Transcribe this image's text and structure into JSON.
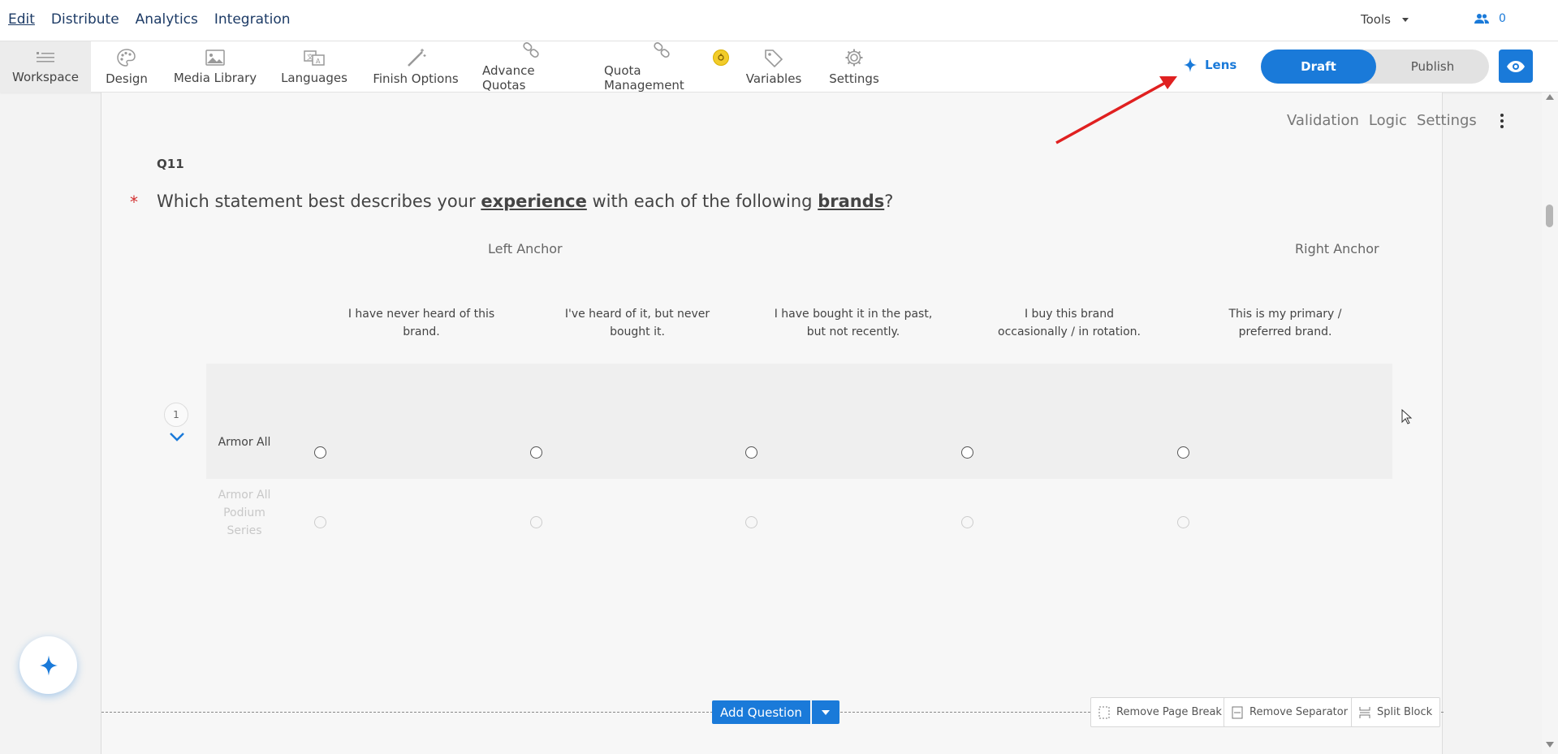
{
  "topnav": {
    "items": [
      "Edit",
      "Distribute",
      "Analytics",
      "Integration"
    ],
    "tools_label": "Tools",
    "user_count": "0"
  },
  "toolbar": {
    "items": [
      {
        "label": "Workspace",
        "icon": "workspace-icon"
      },
      {
        "label": "Design",
        "icon": "palette-icon"
      },
      {
        "label": "Media Library",
        "icon": "image-icon"
      },
      {
        "label": "Languages",
        "icon": "translate-icon"
      },
      {
        "label": "Finish Options",
        "icon": "magic-wand-icon"
      },
      {
        "label": "Advance Quotas",
        "icon": "link-icon"
      },
      {
        "label": "Quota Management",
        "icon": "link-icon"
      },
      {
        "label": "Variables",
        "icon": "tag-icon"
      },
      {
        "label": "Settings",
        "icon": "gear-icon"
      }
    ],
    "lens_label": "Lens",
    "draft_label": "Draft",
    "publish_label": "Publish"
  },
  "question": {
    "actions": [
      "Validation",
      "Logic",
      "Settings"
    ],
    "number": "Q11",
    "required_mark": "*",
    "text_parts": [
      "Which statement best describes your ",
      "experience",
      " with each of the following ",
      "brands",
      "?"
    ],
    "left_anchor": "Left Anchor",
    "right_anchor": "Right Anchor",
    "columns": [
      "I have never heard of this brand.",
      "I've heard of it, but never bought it.",
      "I have bought it in the past, but not recently.",
      "I buy this brand occasionally / in rotation.",
      "This is my primary / preferred brand."
    ],
    "rows": [
      "Armor All",
      "Armor All Podium Series"
    ],
    "row_number": "1"
  },
  "bottom": {
    "add_question": "Add Question",
    "remove_page_break": "Remove Page Break",
    "remove_separator": "Remove Separator",
    "split_block": "Split Block"
  },
  "colors": {
    "accent": "#1a7ad9",
    "required": "#d32f2f",
    "annotation_arrow": "#e02020"
  }
}
